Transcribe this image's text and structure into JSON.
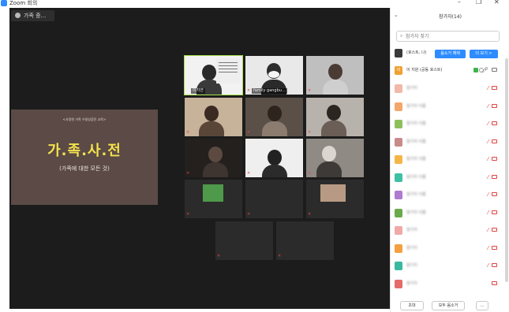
{
  "window": {
    "title": "Zoom 회의",
    "minimize": "–",
    "restore": "❐",
    "close": "✕"
  },
  "room_chip": {
    "label": "가족 중..."
  },
  "shared_screen": {
    "subtitle": "<사랑한 가족 수용성증진 교육>",
    "title": "가.족.사.전",
    "caption": "(가족에 대한 모든 것)"
  },
  "tiles": [
    {
      "name": "이지연"
    },
    {
      "name": "family gangbu..."
    },
    {
      "name": ""
    },
    {
      "name": ""
    },
    {
      "name": ""
    },
    {
      "name": ""
    },
    {
      "name": ""
    },
    {
      "name": ""
    },
    {
      "name": ""
    },
    {
      "name": ""
    },
    {
      "name": ""
    },
    {
      "name": ""
    },
    {
      "name": ""
    },
    {
      "name": ""
    }
  ],
  "panel": {
    "title": "참가자(14)",
    "search_placeholder": "참가자 찾기",
    "host_row": {
      "name": "(호스트, 나)",
      "btn_unmute": "음소거 해제",
      "btn_more": "더 보기 >"
    },
    "cohost_row": {
      "avatar": "이",
      "name": "이 지원 (공동 호스트)"
    },
    "blurred_names": [
      "참가자",
      "참가자 이름",
      "참가자 이름",
      "참가자 이름",
      "참가자 이름",
      "참가자 이름",
      "참가자 이름",
      "참가자 이름",
      "참가자",
      "참가자",
      "참가자",
      "참가자",
      "참가자"
    ],
    "footer": {
      "invite": "초대",
      "mute_all": "모두 음소거",
      "more": "..."
    }
  },
  "colors": {
    "accent": "#2d8cff",
    "active_speaker": "#a7e14a",
    "muted": "#e04242"
  }
}
